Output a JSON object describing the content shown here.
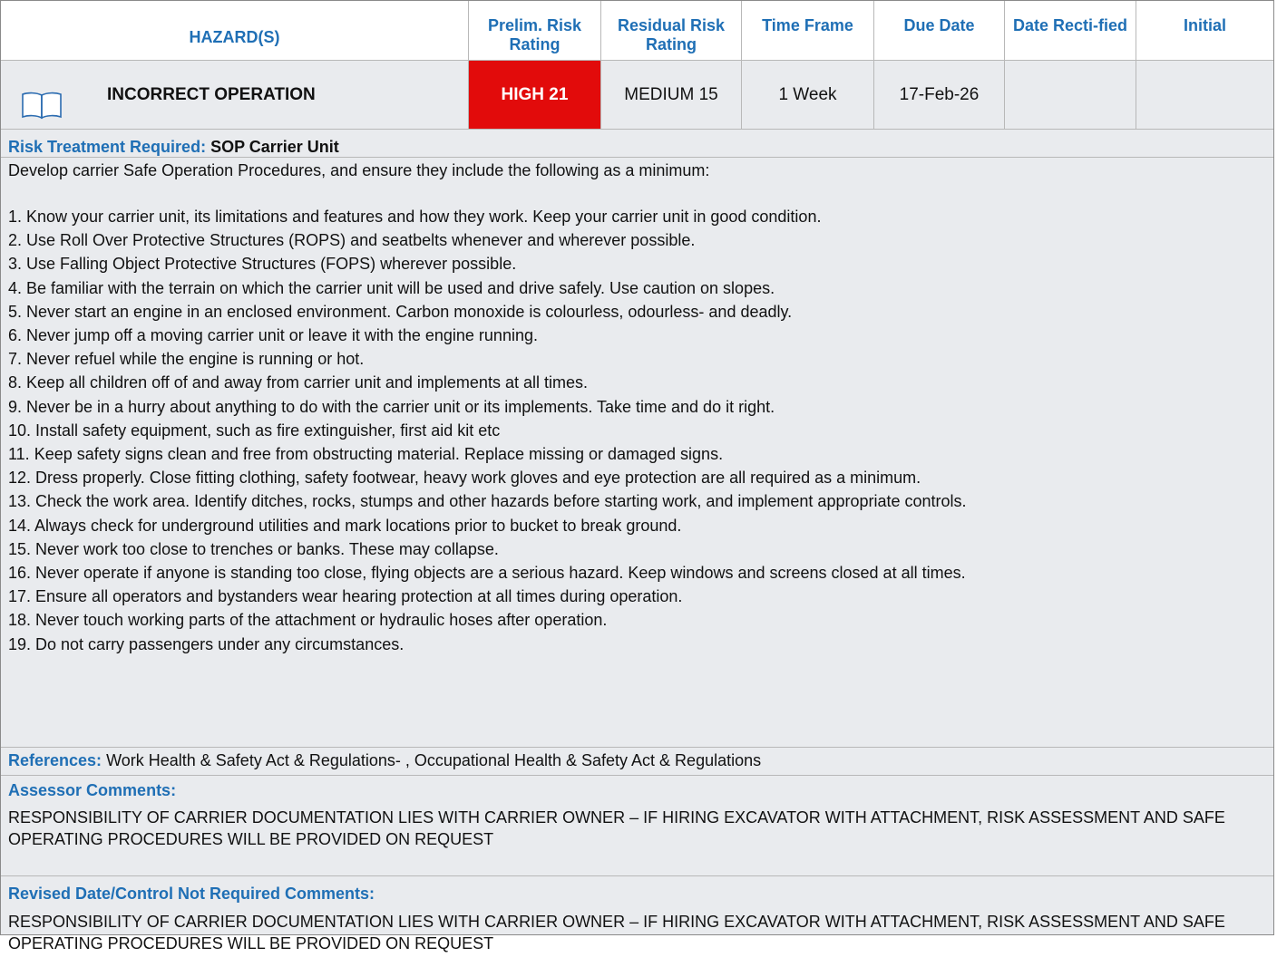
{
  "header": {
    "hazard": "HAZARD(S)",
    "prelim_risk_rating": "Prelim. Risk Rating",
    "residual_risk_rating": "Residual Risk Rating",
    "time_frame": "Time Frame",
    "due_date": "Due Date",
    "date_rectified": "Date Recti-fied",
    "initial": "Initial"
  },
  "row": {
    "hazard_icon": "book-icon",
    "hazard": "INCORRECT OPERATION",
    "prelim_risk_rating": "HIGH 21",
    "residual_risk_rating": "MEDIUM 15",
    "time_frame": "1 Week",
    "due_date": "17-Feb-26",
    "date_rectified": "",
    "initial": ""
  },
  "colors": {
    "accent": "#1f6fb5",
    "high_risk": "#e20b0b",
    "row_bg": "#e9ebee"
  },
  "risk_treatment": {
    "label": "Risk Treatment Required:",
    "value": "SOP Carrier Unit",
    "intro": "Develop carrier Safe Operation Procedures, and ensure they include the following as a minimum:",
    "items": [
      "1. Know your carrier unit, its limitations and features and how they work. Keep your carrier unit in good condition.",
      "2. Use Roll Over Protective Structures (ROPS) and seatbelts whenever and wherever possible.",
      "3. Use Falling Object Protective Structures (FOPS) wherever possible.",
      "4. Be familiar with the terrain on which the carrier unit will be used and drive safely. Use caution on slopes.",
      "5. Never start an engine in an enclosed environment. Carbon monoxide is colourless, odourless- and deadly.",
      "6. Never jump off a moving carrier unit or leave it with the engine running.",
      "7. Never refuel while the engine is running or hot.",
      "8. Keep all children off of and away from carrier unit and implements at all times.",
      "9. Never be in a hurry about anything to do with the carrier unit or its implements. Take time and do it right.",
      "10. Install safety equipment, such as fire extinguisher, first aid kit etc",
      "11. Keep safety signs clean and free from obstructing material. Replace missing or damaged signs.",
      "12. Dress properly. Close fitting clothing, safety footwear, heavy work gloves and eye protection are all required as a minimum.",
      "13. Check the work area. Identify ditches, rocks, stumps and other hazards before starting work, and implement appropriate controls.",
      "14. Always check for underground utilities and mark locations prior to bucket to break ground.",
      "15. Never work too close to trenches or banks. These may collapse.",
      "16. Never operate if anyone is standing too close, flying objects are a serious hazard. Keep windows and screens closed at all times.",
      "17. Ensure all operators and bystanders wear hearing protection at all times during operation.",
      "18. Never touch working parts of the attachment or hydraulic hoses after operation.",
      "19. Do not carry passengers under any circumstances."
    ]
  },
  "references": {
    "label": "References:",
    "value": "Work Health & Safety Act & Regulations- , Occupational Health & Safety Act & Regulations"
  },
  "assessor_comments": {
    "label": "Assessor Comments:",
    "value": "RESPONSIBILITY OF CARRIER DOCUMENTATION LIES WITH CARRIER OWNER – IF HIRING EXCAVATOR WITH ATTACHMENT, RISK ASSESSMENT AND SAFE OPERATING PROCEDURES WILL BE PROVIDED ON REQUEST"
  },
  "revised_comments": {
    "label": "Revised Date/Control Not Required Comments:",
    "value": "RESPONSIBILITY OF CARRIER DOCUMENTATION LIES WITH CARRIER OWNER – IF HIRING EXCAVATOR WITH ATTACHMENT, RISK ASSESSMENT AND SAFE OPERATING PROCEDURES WILL BE PROVIDED ON REQUEST"
  }
}
